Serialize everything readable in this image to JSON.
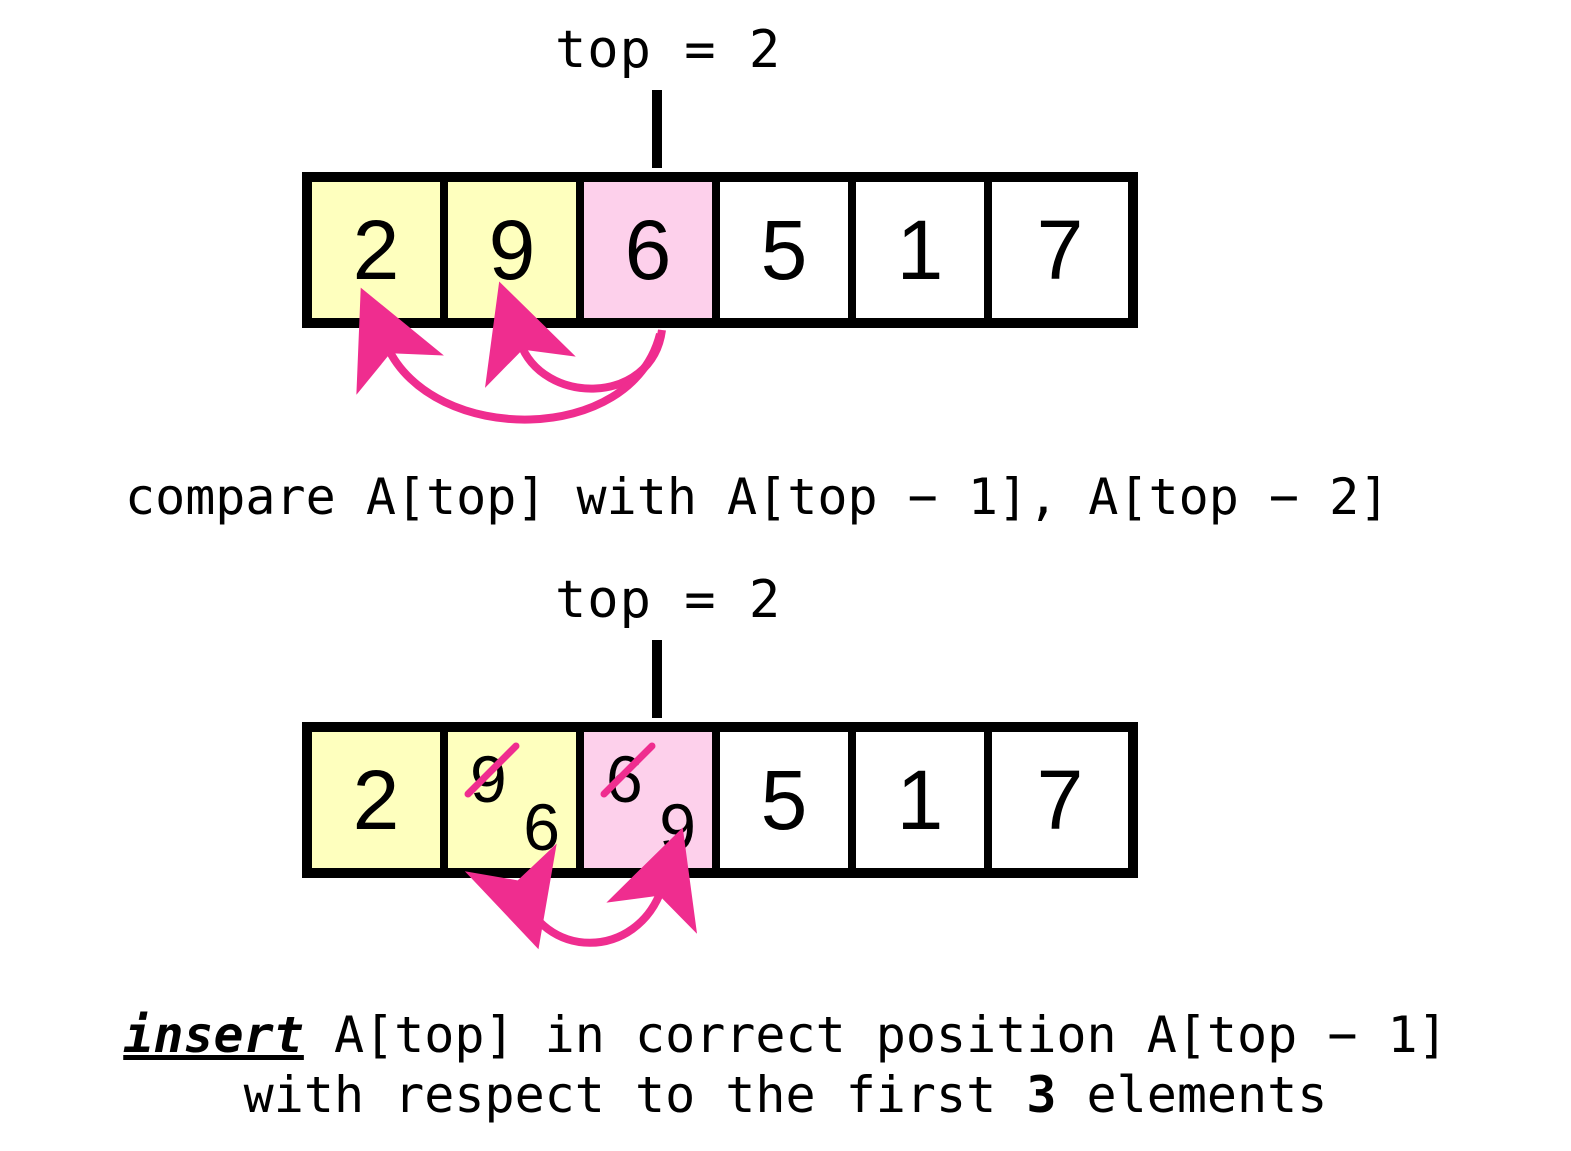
{
  "diagram": {
    "top_label": "top = 2",
    "top_index": 2,
    "arrays": {
      "step1": {
        "cells": [
          {
            "value": "2",
            "color": "yellow"
          },
          {
            "value": "9",
            "color": "yellow"
          },
          {
            "value": "6",
            "color": "pink"
          },
          {
            "value": "5",
            "color": "white"
          },
          {
            "value": "1",
            "color": "white"
          },
          {
            "value": "7",
            "color": "white"
          }
        ]
      },
      "step2": {
        "cells": [
          {
            "value": "2",
            "color": "yellow"
          },
          {
            "old": "9",
            "new": "6",
            "color": "yellow",
            "struck": true
          },
          {
            "old": "6",
            "new": "9",
            "color": "pink",
            "struck": true
          },
          {
            "value": "5",
            "color": "white"
          },
          {
            "value": "1",
            "color": "white"
          },
          {
            "value": "7",
            "color": "white"
          }
        ]
      }
    },
    "captions": {
      "step1": "compare A[top] with A[top − 1], A[top − 2]",
      "step2_prefix_insert": "insert",
      "step2_line1_rest": " A[top] in correct position A[top − 1]",
      "step2_line2_a": "with respect to the first ",
      "step2_line2_bold": "3",
      "step2_line2_b": " elements"
    },
    "colors": {
      "sorted": "#feffbe",
      "current": "#fdd0eb",
      "arrow": "#ef2d8f"
    }
  }
}
